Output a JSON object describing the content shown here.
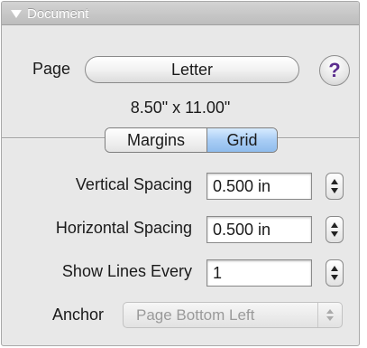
{
  "panel": {
    "title": "Document",
    "page_label": "Page",
    "page_value": "Letter",
    "page_dimensions": "8.50\" x 11.00\"",
    "help_label": "?"
  },
  "tabs": {
    "margins_label": "Margins",
    "grid_label": "Grid",
    "selected": "Grid"
  },
  "grid": {
    "vertical_spacing_label": "Vertical Spacing",
    "vertical_spacing_value": "0.500 in",
    "horizontal_spacing_label": "Horizontal Spacing",
    "horizontal_spacing_value": "0.500 in",
    "show_lines_label": "Show Lines Every",
    "show_lines_value": "1",
    "anchor_label": "Anchor",
    "anchor_value": "Page Bottom Left"
  },
  "icons": [
    "disclosure-triangle-icon",
    "help-icon",
    "stepper-icon",
    "popup-arrows-icon"
  ],
  "colors": {
    "selected_tab": "#a9cdf5",
    "help_glyph": "#5b2d8e",
    "disabled_text": "#9a9a9a"
  }
}
